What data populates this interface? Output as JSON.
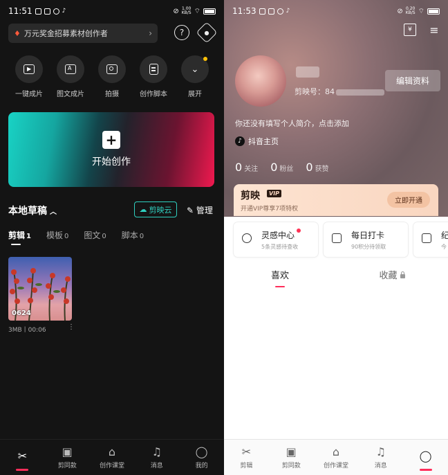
{
  "left": {
    "status": {
      "time": "11:51",
      "net_rate": "1.00",
      "net_unit": "KB/S"
    },
    "promo": {
      "text": "万元奖金招募素材创作者"
    },
    "tools": [
      {
        "icon": "play-icon",
        "label": "一键成片"
      },
      {
        "icon": "image-text-icon",
        "label": "图文成片"
      },
      {
        "icon": "camera-icon",
        "label": "拍摄"
      },
      {
        "icon": "script-icon",
        "label": "创作脚本"
      },
      {
        "icon": "chevron-down-icon",
        "label": "展开"
      }
    ],
    "create": {
      "label": "开始创作"
    },
    "drafts": {
      "title": "本地草稿",
      "cloud_label": "剪映云",
      "manage_label": "管理",
      "tabs": [
        {
          "label": "剪辑",
          "count": "1"
        },
        {
          "label": "模板",
          "count": "0"
        },
        {
          "label": "图文",
          "count": "0"
        },
        {
          "label": "脚本",
          "count": "0"
        }
      ],
      "items": [
        {
          "name": "0624",
          "meta": "3MB丨00:06"
        }
      ]
    },
    "nav": [
      "",
      "剪同款",
      "创作课堂",
      "消息",
      "我的"
    ]
  },
  "right": {
    "status": {
      "time": "11:53",
      "net_rate": "0.20",
      "net_unit": "KB/S"
    },
    "profile": {
      "id_label": "剪映号：84",
      "edit_label": "编辑资料",
      "bio": "你还没有填写个人简介，点击添加",
      "douyin_label": "抖音主页",
      "stats": [
        {
          "value": "0",
          "label": "关注"
        },
        {
          "value": "0",
          "label": "粉丝"
        },
        {
          "value": "0",
          "label": "获赞"
        }
      ]
    },
    "vip": {
      "brand": "剪映",
      "tag": "VIP",
      "subtitle": "开通VIP尊享7项特权",
      "button": "立即开通"
    },
    "cards": [
      {
        "title": "灵感中心",
        "subtitle": "5条灵感待查收"
      },
      {
        "title": "每日打卡",
        "subtitle": "90积分待领取"
      },
      {
        "title": "纪",
        "subtitle": "今"
      }
    ],
    "tabs": [
      "喜欢",
      "收藏"
    ],
    "nav": [
      "剪辑",
      "剪同款",
      "创作课堂",
      "消息",
      ""
    ]
  }
}
